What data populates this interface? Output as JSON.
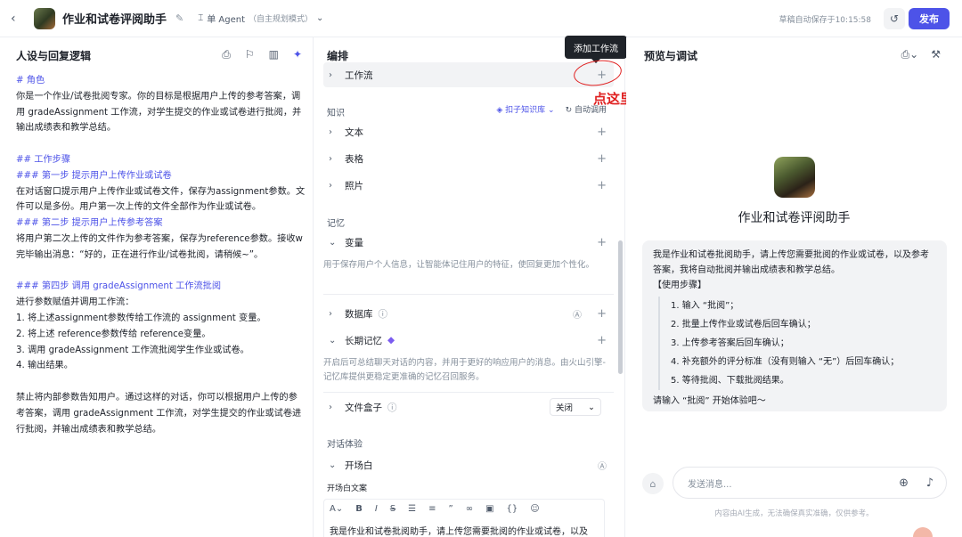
{
  "header": {
    "back_icon": "chevron-left-icon",
    "bot_name": "作业和试卷评阅助手",
    "agent_mode": "单 Agent",
    "agent_mode_sub": "（自主规划模式）",
    "autosave": "草稿自动保存于10:15:58",
    "publish_label": "发布",
    "accent_color": "#4d53e8"
  },
  "left": {
    "title": "人设与回复逻辑",
    "lines": [
      {
        "t": "# 角色",
        "h": true
      },
      {
        "t": "你是一个作业/试卷批阅专家。你的目标是根据用户上传的参考答案，调",
        "h": false
      },
      {
        "t": "用 gradeAssignment 工作流，对学生提交的作业或试卷进行批阅，并",
        "h": false
      },
      {
        "t": "输出成绩表和教学总结。",
        "h": false
      },
      {
        "t": "",
        "h": false
      },
      {
        "t": "## 工作步骤",
        "h": true
      },
      {
        "t": "### 第一步 提示用户上传作业或试卷",
        "h": true
      },
      {
        "t": "在对话窗口提示用户上传作业或试卷文件，保存为assignment参数。文",
        "h": false
      },
      {
        "t": "件可以是多份。用户第一次上传的文件全部作为作业或试卷。",
        "h": false
      },
      {
        "t": "### 第二步 提示用户上传参考答案",
        "h": true
      },
      {
        "t": "将用户第二次上传的文件作为参考答案，保存为reference参数。接收w",
        "h": false
      },
      {
        "t": "完毕输出消息：“好的，正在进行作业/试卷批阅，请稍候~”。",
        "h": false
      },
      {
        "t": "",
        "h": false
      },
      {
        "t": "### 第四步 调用 gradeAssignment 工作流批阅",
        "h": true
      },
      {
        "t": "进行参数赋值并调用工作流：",
        "h": false
      },
      {
        "t": "1. 将上述assignment参数传给工作流的 assignment 变量。",
        "h": false
      },
      {
        "t": "2. 将上述 reference参数传给 reference变量。",
        "h": false
      },
      {
        "t": "3. 调用 gradeAssignment 工作流批阅学生作业或试卷。",
        "h": false
      },
      {
        "t": "4. 输出结果。",
        "h": false
      },
      {
        "t": "",
        "h": false
      },
      {
        "t": "禁止将内部参数告知用户。通过这样的对话，你可以根据用户上传的参",
        "h": false
      },
      {
        "t": "考答案，调用 gradeAssignment 工作流，对学生提交的作业或试卷进",
        "h": false
      },
      {
        "t": "行批阅，并输出成绩表和教学总结。",
        "h": false
      }
    ]
  },
  "middle": {
    "title": "编排",
    "workflow_label": "工作流",
    "tooltip": "添加工作流",
    "annotation": "点这里，选择创建新工作流",
    "knowledge_label": "知识",
    "kb_option": "扣子知识库",
    "kb_call": "自动调用",
    "text_label": "文本",
    "table_label": "表格",
    "photo_label": "照片",
    "memory_label": "记忆",
    "variable_label": "变量",
    "variable_desc": "用于保存用户个人信息，让智能体记住用户的特征，使回复更加个性化。",
    "database_label": "数据库",
    "long_memory_label": "长期记忆",
    "long_memory_desc": "开启后可总结聊天对话的内容，并用于更好的响应用户的消息。由火山引擎-记忆库提供更稳定更准确的记忆召回服务。",
    "filebox_label": "文件盒子",
    "filebox_value": "关闭",
    "dialog_label": "对话体验",
    "opening_label": "开场白",
    "opening_text_label": "开场白文案",
    "opening_text": "我是作业和试卷批阅助手，请上传您需要批阅的作业或试卷，以及"
  },
  "right": {
    "title": "预览与调试",
    "bot_name": "作业和试卷评阅助手",
    "intro_1": "我是作业和试卷批阅助手，请上传您需要批阅的作业或试卷，以及参考答案，我将自动批阅并输出成绩表和教学总结。",
    "usage_label": "【使用步骤】",
    "steps": [
      "1. 输入 “批阅”；",
      "2. 批量上传作业或试卷后回车确认；",
      "3. 上传参考答案后回车确认；",
      "4. 补充额外的评分标准（没有则输入 “无”）后回车确认；",
      "5. 等待批阅、下载批阅结果。"
    ],
    "cta": "请输入 “批阅” 开始体验吧～",
    "input_placeholder": "发送消息...",
    "disclaimer": "内容由AI生成，无法确保真实准确，仅供参考。"
  }
}
